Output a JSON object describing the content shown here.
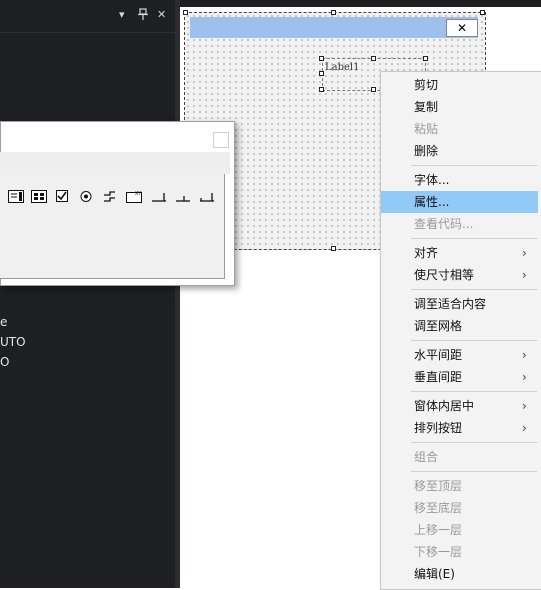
{
  "side_panel": {
    "header_icons": [
      "chevron-down-icon",
      "pin-icon",
      "close-icon"
    ],
    "close_glyph": "✕",
    "pin_glyph": "🖈",
    "dropdown_glyph": "▾",
    "lines": [
      "e",
      "UTO",
      "O"
    ]
  },
  "form": {
    "close_glyph": "✕",
    "label_text": "Label1"
  },
  "toolbox": {
    "icons": [
      "textbox-icon",
      "listbox-icon",
      "checkbox-icon",
      "radio-icon",
      "groupbox-icon",
      "panel-icon",
      "hscroll-icon",
      "vscroll-icon",
      "tray-icon"
    ]
  },
  "context_menu": {
    "submenu_arrow": "›",
    "items": [
      {
        "label": "剪切",
        "enabled": true
      },
      {
        "label": "复制",
        "enabled": true
      },
      {
        "label": "粘贴",
        "enabled": false
      },
      {
        "label": "删除",
        "enabled": true
      },
      {
        "label": "字体...",
        "enabled": true
      },
      {
        "label": "属性...",
        "enabled": true,
        "highlighted": true
      },
      {
        "label": "查看代码...",
        "enabled": false
      },
      {
        "label": "对齐",
        "enabled": true,
        "submenu": true
      },
      {
        "label": "使尺寸相等",
        "enabled": true,
        "submenu": true
      },
      {
        "label": "调至适合内容",
        "enabled": true
      },
      {
        "label": "调至网格",
        "enabled": true
      },
      {
        "label": "水平间距",
        "enabled": true,
        "submenu": true
      },
      {
        "label": "垂直间距",
        "enabled": true,
        "submenu": true
      },
      {
        "label": "窗体内居中",
        "enabled": true,
        "submenu": true
      },
      {
        "label": "排列按钮",
        "enabled": true,
        "submenu": true
      },
      {
        "label": "组合",
        "enabled": false
      },
      {
        "label": "移至顶层",
        "enabled": false
      },
      {
        "label": "移至底层",
        "enabled": false
      },
      {
        "label": "上移一层",
        "enabled": false
      },
      {
        "label": "下移一层",
        "enabled": false
      },
      {
        "label": "编辑(E)",
        "enabled": true
      }
    ]
  },
  "colors": {
    "dark_bg": "#1e1f22",
    "title_bar": "#9dc1ec",
    "menu_highlight": "#91c9f7",
    "menu_bg": "#f3f3f3"
  }
}
